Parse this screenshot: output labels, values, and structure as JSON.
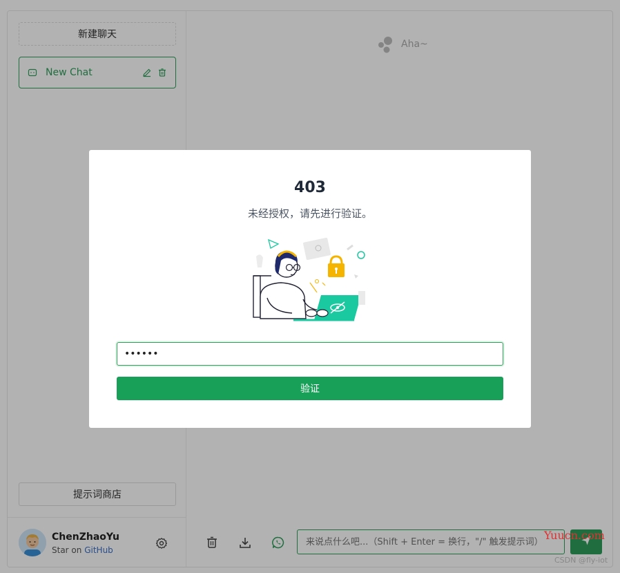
{
  "sidebar": {
    "new_chat_label": "新建聊天",
    "chat_items": [
      {
        "label": "New Chat"
      }
    ],
    "prompt_store_label": "提示词商店"
  },
  "user": {
    "name": "ChenZhaoYu",
    "star_prefix": "Star on",
    "github_label": "GitHub"
  },
  "main": {
    "greeting": "Aha~",
    "input_placeholder": "来说点什么吧...（Shift + Enter = 换行，\"/\" 触发提示词）"
  },
  "modal": {
    "title": "403",
    "description": "未经授权，请先进行验证。",
    "password_value": "••••••",
    "verify_label": "验证"
  },
  "watermark": {
    "site": "Yuucn.com",
    "credit": "CSDN @fly-iot"
  },
  "colors": {
    "accent": "#18a058",
    "accent_dark": "#2e9e5b",
    "overlay": "rgba(0,0,0,0.30)"
  },
  "icons": {
    "chat_item": "message-icon",
    "edit": "edit-icon",
    "delete": "trash-icon",
    "settings": "gear-icon",
    "clear": "trash-icon",
    "export": "download-icon",
    "chat_mode": "whatsapp-chat-icon",
    "send": "send-icon"
  }
}
